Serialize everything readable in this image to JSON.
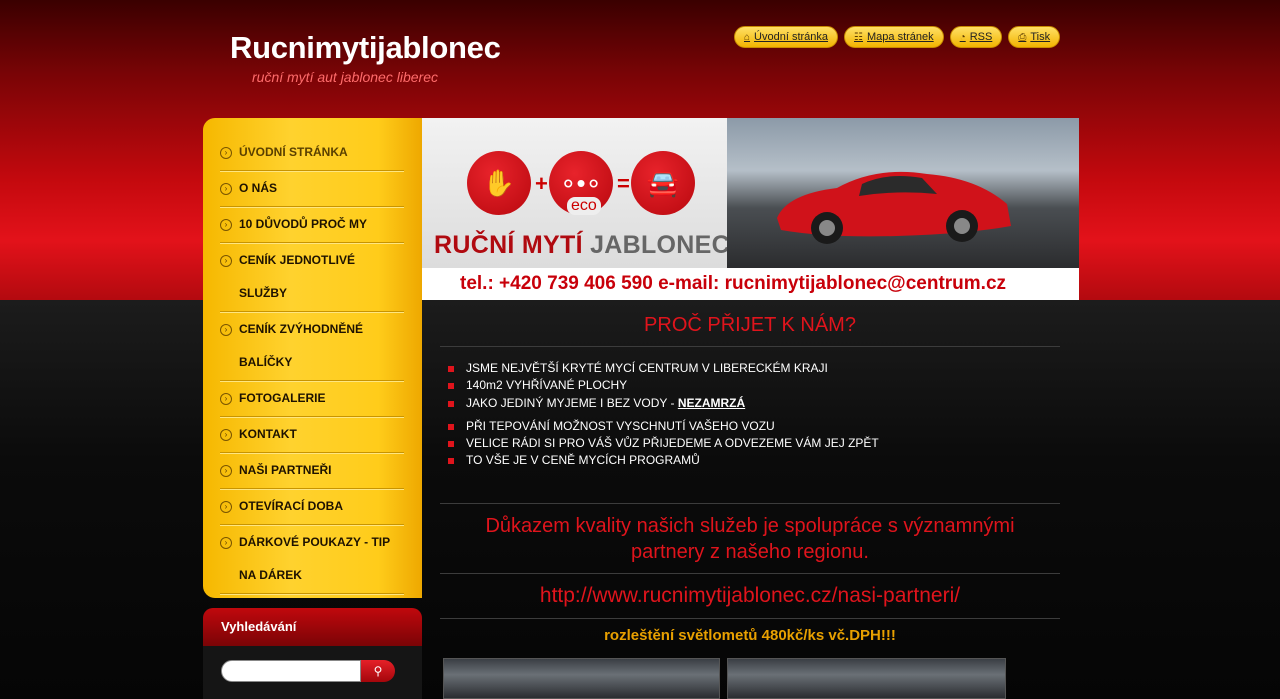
{
  "header": {
    "site_title": "Rucnimytijablonec",
    "site_subtitle": "ruční mytí aut jablonec liberec"
  },
  "top_links": [
    {
      "label": "Úvodní stránka",
      "icon": "home-icon"
    },
    {
      "label": "Mapa stránek",
      "icon": "sitemap-icon"
    },
    {
      "label": "RSS",
      "icon": "rss-icon"
    },
    {
      "label": "Tisk",
      "icon": "print-icon"
    }
  ],
  "menu": [
    {
      "label": "ÚVODNÍ STRÁNKA",
      "active": true
    },
    {
      "label": "O NÁS"
    },
    {
      "label": "10 DŮVODŮ PROČ MY"
    },
    {
      "label": "CENÍK JEDNOTLIVÉ SLUŽBY"
    },
    {
      "label": "CENÍK ZVÝHODNĚNÉ BALÍČKY"
    },
    {
      "label": "FOTOGALERIE"
    },
    {
      "label": "KONTAKT"
    },
    {
      "label": "NAŠI PARTNEŘI"
    },
    {
      "label": "OTEVÍRACÍ DOBA"
    },
    {
      "label": "DÁRKOVÉ POUKAZY - TIP NA DÁREK"
    }
  ],
  "search": {
    "heading": "Vyhledávání",
    "placeholder": ""
  },
  "banner": {
    "logo_text_red": "RUČNÍ MYTÍ",
    "logo_text_grey": "JABLONEC.CZ",
    "eco": "eco",
    "contact": "tel.:  +420 739 406 590  e-mail: rucnimytijablonec@centrum.cz"
  },
  "content": {
    "heading": "PROČ PŘIJET K NÁM?",
    "bullets": [
      "JSME NEJVĚTŠÍ KRYTÉ MYCÍ CENTRUM V LIBERECKÉM KRAJI",
      "140m2 VYHŘÍVANÉ PLOCHY",
      "JAKO JEDINÝ MYJEME I BEZ VODY - ",
      "PŘI TEPOVÁNÍ MOŽNOST VYSCHNUTÍ VAŠEHO VOZU",
      "VELICE RÁDI SI PRO VÁŠ VŮZ PŘIJEDEME A ODVEZEME VÁM JEJ ZPĚT",
      "TO VŠE JE V CENĚ MYCÍCH PROGRAMŮ"
    ],
    "bullet_emphasis": "NEZAMRZÁ",
    "proof_line1": "Důkazem kvality našich služeb je spolupráce s významnými",
    "proof_line2": "partnery z našeho regionu.",
    "partners_url": "http://www.rucnimytijablonec.cz/nasi-partneri/",
    "offer": "rozleštění světlometů 480kč/ks vč.DPH!!!"
  },
  "colors": {
    "accent_red": "#e0141c",
    "menu_yellow": "#ffcc1a",
    "offer_orange": "#e8a000"
  }
}
